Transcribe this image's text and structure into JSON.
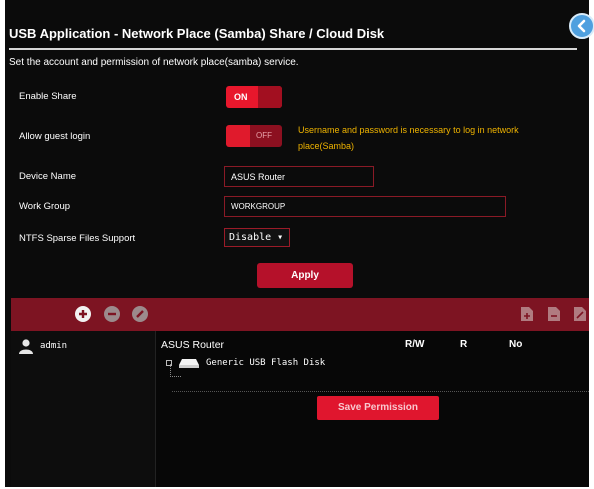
{
  "header": {
    "title": "USB Application - Network Place (Samba) Share / Cloud Disk",
    "description": "Set the account and permission of network place(samba) service."
  },
  "settings": {
    "enable_share": {
      "label": "Enable Share",
      "toggle_text": "ON",
      "state": "on"
    },
    "allow_guest": {
      "label": "Allow guest login",
      "toggle_text": "OFF",
      "state": "off",
      "note": "Username and password is necessary to log in network place(Samba)"
    },
    "device_name": {
      "label": "Device Name",
      "value": "ASUS Router"
    },
    "work_group": {
      "label": "Work Group",
      "value": "WORKGROUP"
    },
    "ntfs_sparse": {
      "label": "NTFS Sparse Files Support",
      "value": "Disable ▾"
    }
  },
  "apply_label": "Apply",
  "toolbar": {
    "icons": [
      "add-icon",
      "remove-icon",
      "edit-icon",
      "add-folder-icon",
      "delete-folder-icon",
      "rename-folder-icon"
    ]
  },
  "accounts": [
    {
      "name": "admin"
    }
  ],
  "permissions": {
    "device": "ASUS Router",
    "headers": [
      "R/W",
      "R",
      "No"
    ],
    "disks": [
      {
        "name": "Generic USB Flash Disk"
      }
    ]
  },
  "save_permission_label": "Save Permission",
  "colors": {
    "background": "#0b0b0b",
    "accent_red": "#e8172c",
    "toolbar_red": "#7d1422",
    "note_yellow": "#f0b400",
    "back_button_blue": "#4fa0df"
  }
}
